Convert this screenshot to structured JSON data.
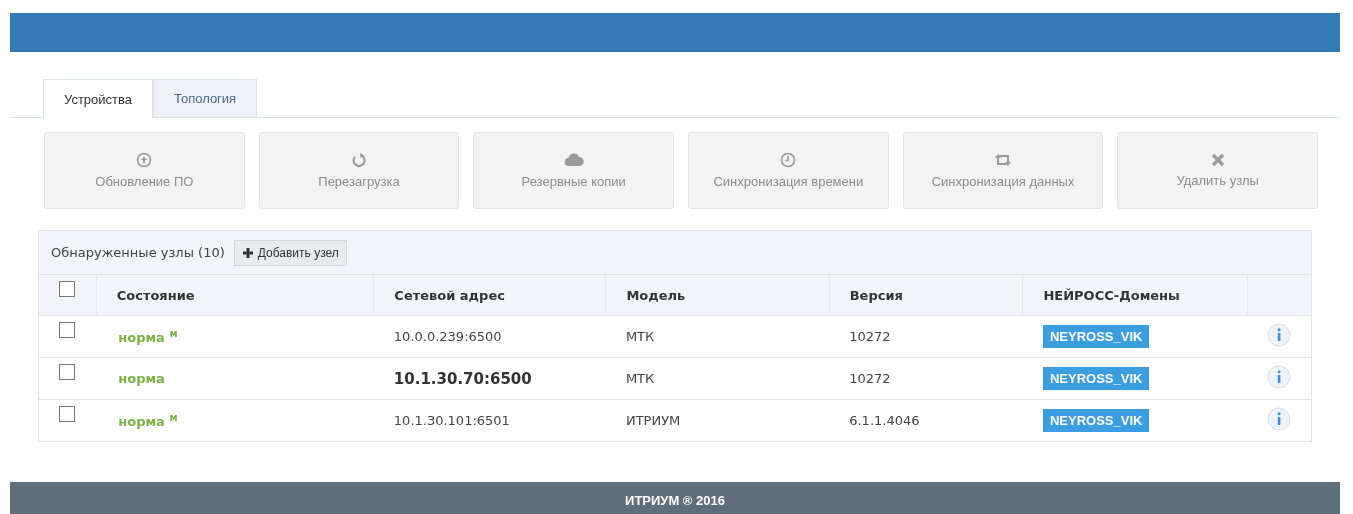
{
  "tabs": [
    {
      "label": "Устройства",
      "selected": true
    },
    {
      "label": "Топология",
      "selected": false
    }
  ],
  "actions": [
    {
      "kind": "update",
      "label": "Обновление ПО"
    },
    {
      "kind": "reload",
      "label": "Перезагрузка"
    },
    {
      "kind": "backup",
      "label": "Резервные копии"
    },
    {
      "kind": "time",
      "label": "Синхронизация времени"
    },
    {
      "kind": "sync",
      "label": "Синхронизация данных"
    },
    {
      "kind": "delete",
      "label": "Удалить узлы"
    }
  ],
  "nodes_panel": {
    "title": "Обнаруженные узлы (10)",
    "add_button": "Добавить узел",
    "columns": [
      "Состояние",
      "Сетевой адрес",
      "Модель",
      "Версия",
      "НЕЙРОСС-Домены"
    ],
    "header_checked": false,
    "rows": [
      {
        "checked": false,
        "status": "норма $^{м}$",
        "address": "10.0.0.239:6500",
        "bold": false,
        "model": "МТК",
        "version": "10272",
        "domain": "NEYROSS_VIK"
      },
      {
        "checked": false,
        "status": "норма",
        "address": "10.1.30.70:6500",
        "bold": true,
        "model": "МТК",
        "version": "10272",
        "domain": "NEYROSS_VIK"
      },
      {
        "checked": false,
        "status": "норма $^{м}$",
        "address": "10.1.30.101:6501",
        "bold": false,
        "model": "ИТРИУМ",
        "version": "6.1.1.4046",
        "domain": "NEYROSS_VIK"
      }
    ]
  },
  "footer": "ИТРИУМ ® 2016"
}
